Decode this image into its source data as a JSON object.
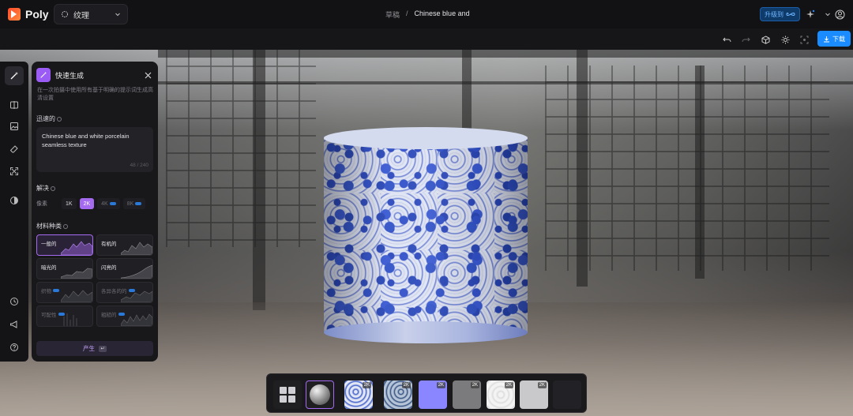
{
  "app": {
    "name": "Poly"
  },
  "header": {
    "selector_label": "纹理",
    "breadcrumb_parent": "草稿",
    "breadcrumb_current": "Chinese blue and w",
    "upgrade_label": "升级到"
  },
  "toolbar": {
    "download_label": "下载"
  },
  "panel": {
    "title": "快速生成",
    "description": "在一次拍摄中使用所有基于明确的提示词生成高清设置",
    "prompt_label": "迅速的",
    "prompt_value": "Chinese blue and white porcelain seamless texture",
    "char_count": "48 / 240",
    "resolution_label": "解决",
    "pixel_label": "像素",
    "resolutions": [
      {
        "label": "1K",
        "selected": false,
        "locked": false
      },
      {
        "label": "2K",
        "selected": true,
        "locked": false
      },
      {
        "label": "4K",
        "selected": false,
        "locked": true
      },
      {
        "label": "8K",
        "selected": false,
        "locked": true
      }
    ],
    "material_label": "材料种类",
    "materials": [
      {
        "label": "一般的",
        "selected": true,
        "locked": false
      },
      {
        "label": "有机的",
        "selected": false,
        "locked": false
      },
      {
        "label": "暗光的",
        "selected": false,
        "locked": false
      },
      {
        "label": "闪亮的",
        "selected": false,
        "locked": false
      },
      {
        "label": "织物",
        "selected": false,
        "locked": true
      },
      {
        "label": "各异各的的",
        "selected": false,
        "locked": true
      },
      {
        "label": "可配性",
        "selected": false,
        "locked": true
      },
      {
        "label": "粗糙的",
        "selected": false,
        "locked": true
      }
    ],
    "generate_label": "产生"
  },
  "strip": {
    "thumbs": [
      {
        "name": "grid-view",
        "tag": ""
      },
      {
        "name": "sphere-preview",
        "tag": ""
      },
      {
        "name": "base-color-map",
        "tag": "2K"
      },
      {
        "name": "ao-map",
        "tag": "2K"
      },
      {
        "name": "normal-map",
        "tag": "2K"
      },
      {
        "name": "height-map",
        "tag": "2K"
      },
      {
        "name": "roughness-map",
        "tag": "2K"
      },
      {
        "name": "metallic-map",
        "tag": "2K"
      },
      {
        "name": "empty-slot",
        "tag": ""
      }
    ]
  },
  "colors": {
    "accent_purple": "#a46af0",
    "download_blue": "#1b8cff",
    "upgrade_blue": "#6fb6ff",
    "porcelain_blue": "#2f4fc9"
  }
}
